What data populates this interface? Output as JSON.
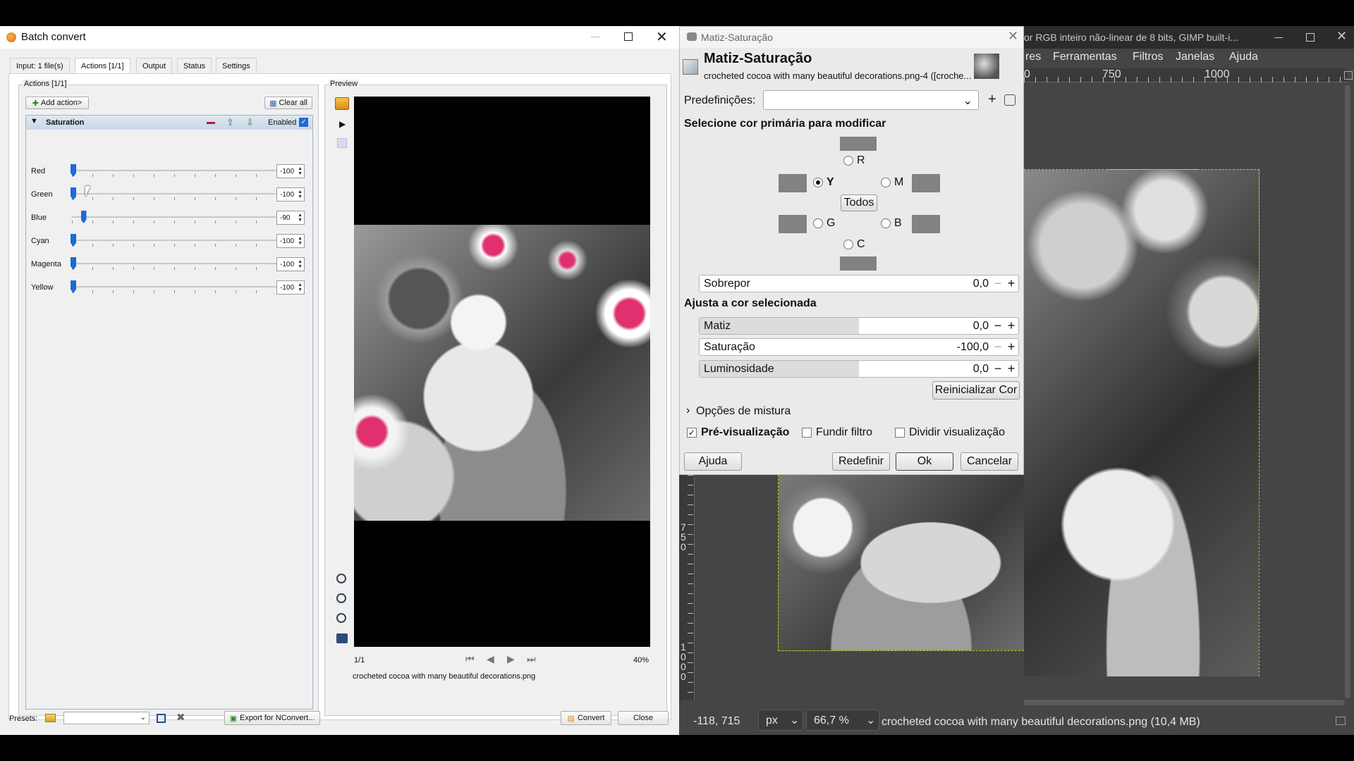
{
  "batch": {
    "title": "Batch convert",
    "tabs": [
      "Input: 1 file(s)",
      "Actions [1/1]",
      "Output",
      "Status",
      "Settings"
    ],
    "actions_group": "Actions [1/1]",
    "add_action": "Add action>",
    "clear_all": "Clear all",
    "action_name": "Saturation",
    "enabled_label": "Enabled",
    "sliders": [
      {
        "label": "Red",
        "value": "-100",
        "level": 0
      },
      {
        "label": "Green",
        "value": "-100",
        "level": 0
      },
      {
        "label": "Blue",
        "value": "-90",
        "level": 0.05
      },
      {
        "label": "Cyan",
        "value": "-100",
        "level": 0
      },
      {
        "label": "Magenta",
        "value": "-100",
        "level": 0
      },
      {
        "label": "Yellow",
        "value": "-100",
        "level": 0
      }
    ],
    "preview_group": "Preview",
    "page_indicator": "1/1",
    "zoom": "40%",
    "filename": "crocheted cocoa with many beautiful decorations.png",
    "presets_label": "Presets:",
    "export_button": "Export for NConvert...",
    "convert_button": "Convert",
    "close_button": "Close"
  },
  "gimp": {
    "title_fragment": "or RGB inteiro não-linear de 8 bits, GIMP built-i...",
    "menu": [
      "res",
      "Ferramentas",
      "Filtros",
      "Janelas",
      "Ajuda"
    ],
    "ruler_labels": [
      "0",
      "750",
      "1000"
    ],
    "vruler_labels": [
      "7",
      "5",
      "0",
      "1",
      "0",
      "0",
      "0"
    ],
    "coords": "-118, 715",
    "unit": "px",
    "zoom": "66,7 %",
    "status": "crocheted cocoa with many beautiful decorations.png (10,4 MB)"
  },
  "dialog": {
    "window_title": "Matiz-Saturação",
    "heading": "Matiz-Saturação",
    "subheading": "crocheted cocoa with many beautiful decorations.png-4 ([croche...",
    "presets_label": "Predefinições:",
    "section_primary": "Selecione cor primária para modificar",
    "radios": {
      "R": "R",
      "Y": "Y",
      "M": "M",
      "G": "G",
      "B": "B",
      "C": "C"
    },
    "all_button": "Todos",
    "overlap": {
      "label": "Sobrepor",
      "value": "0,0"
    },
    "section_adjust": "Ajusta a cor selecionada",
    "hue": {
      "label": "Matiz",
      "value": "0,0",
      "level": 0.5
    },
    "saturation": {
      "label": "Saturação",
      "value": "-100,0",
      "level": 0
    },
    "lightness": {
      "label": "Luminosidade",
      "value": "0,0",
      "level": 0.5
    },
    "reset_color": "Reinicializar Cor",
    "blend_options": "Opções de mistura",
    "preview_check": "Pré-visualização",
    "merge_filter": "Fundir filtro",
    "split_view": "Dividir visualização",
    "help": "Ajuda",
    "reset": "Redefinir",
    "ok": "Ok",
    "cancel": "Cancelar"
  },
  "colors": {
    "accent": "#1e6ad6",
    "magenta_flower": "#e0306f"
  }
}
